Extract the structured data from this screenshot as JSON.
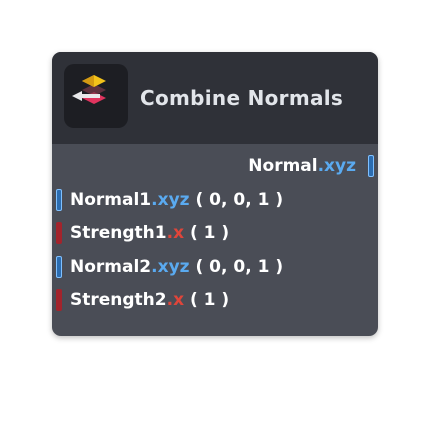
{
  "node": {
    "title": "Combine Normals",
    "icon": "stacked-layers-icon",
    "colors": {
      "header_bg": "#2f3138",
      "body_bg": "#4a4d56",
      "vector_swizzle": "#5aaaf0",
      "scalar_swizzle": "#e0453a",
      "vector_port": "#2b6cb0",
      "scalar_port": "#a3242c"
    },
    "output": {
      "name": "Normal",
      "swizzle": ".xyz"
    },
    "inputs": [
      {
        "name": "Normal1",
        "swizzle": ".xyz",
        "value": "( 0, 0, 1 )"
      },
      {
        "name": "Strength1",
        "swizzle": ".x",
        "value": "( 1 )"
      },
      {
        "name": "Normal2",
        "swizzle": ".xyz",
        "value": "( 0, 0, 1 )"
      },
      {
        "name": "Strength2",
        "swizzle": ".x",
        "value": "( 1 )"
      }
    ]
  }
}
